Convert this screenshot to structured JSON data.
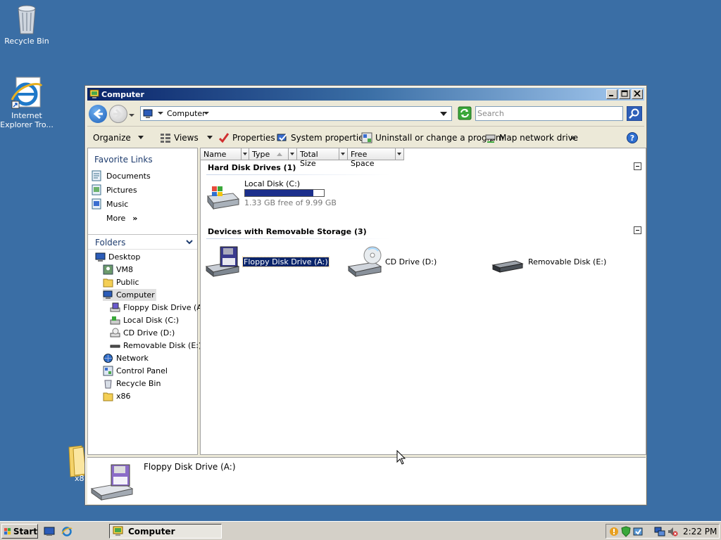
{
  "desktop": {
    "icons": [
      {
        "label": "Recycle Bin"
      },
      {
        "label": "Internet Explorer Tro..."
      },
      {
        "label": "x8"
      }
    ]
  },
  "window": {
    "title": "Computer",
    "address": {
      "segment": "Computer"
    },
    "search": {
      "placeholder": "Search"
    },
    "toolbar": {
      "organize": "Organize",
      "views": "Views",
      "properties": "Properties",
      "system_properties": "System properties",
      "uninstall": "Uninstall or change a program",
      "map_drive": "Map network drive",
      "more": "»"
    },
    "favorites": {
      "title": "Favorite Links",
      "items": [
        {
          "label": "Documents"
        },
        {
          "label": "Pictures"
        },
        {
          "label": "Music"
        },
        {
          "label": "More"
        }
      ],
      "more_arrow": "»"
    },
    "folders": {
      "title": "Folders",
      "tree": [
        {
          "label": "Desktop"
        },
        {
          "label": "VM8"
        },
        {
          "label": "Public"
        },
        {
          "label": "Computer"
        },
        {
          "label": "Floppy Disk Drive (A:)"
        },
        {
          "label": "Local Disk (C:)"
        },
        {
          "label": "CD Drive (D:)"
        },
        {
          "label": "Removable Disk (E:)"
        },
        {
          "label": "Network"
        },
        {
          "label": "Control Panel"
        },
        {
          "label": "Recycle Bin"
        },
        {
          "label": "x86"
        }
      ]
    },
    "columns": [
      {
        "label": "Name"
      },
      {
        "label": "Type"
      },
      {
        "label": "Total Size"
      },
      {
        "label": "Free Space"
      }
    ],
    "groups": {
      "hard_disks": {
        "title": "Hard Disk Drives (1)",
        "drives": [
          {
            "name": "Local Disk (C:)",
            "free_text": "1.33 GB free of 9.99 GB",
            "used_fraction": 0.867
          }
        ]
      },
      "removable": {
        "title": "Devices with Removable Storage (3)",
        "drives": [
          {
            "name": "Floppy Disk Drive (A:)",
            "selected": true
          },
          {
            "name": "CD Drive (D:)"
          },
          {
            "name": "Removable Disk (E:)"
          }
        ]
      }
    },
    "details": {
      "name": "Floppy Disk Drive (A:)"
    }
  },
  "taskbar": {
    "start": "Start",
    "task": "Computer",
    "clock": "2:22 PM"
  },
  "colors": {
    "desktop": "#3a6ea5",
    "selection": "#0a246a",
    "disk_bar": "#1c2f8c"
  }
}
